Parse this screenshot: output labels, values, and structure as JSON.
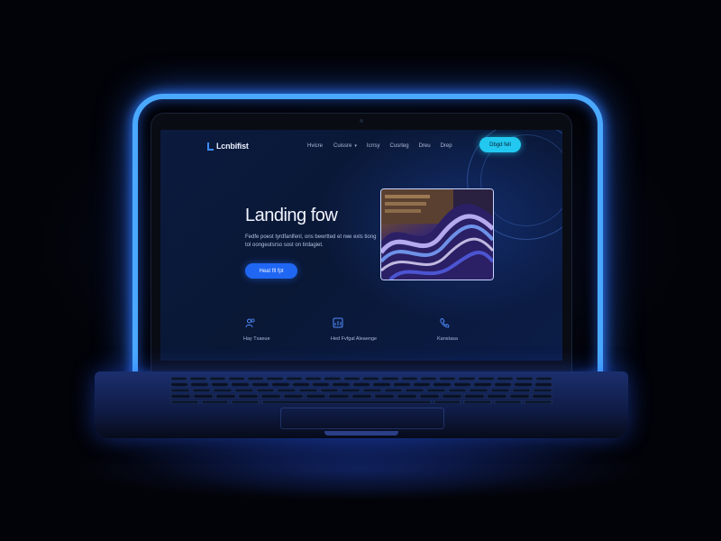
{
  "nav": {
    "logo_text": "Lcnbifist",
    "links": [
      "Hvicre",
      "Cuissre",
      "Icrrsy",
      "Cusrteg",
      "Dreu",
      "Drep"
    ],
    "cta_label": "Dbgd fell"
  },
  "hero": {
    "title": "Landing fow",
    "body": "Fedfe poest tyrdfanlfenl, ons bewrtted et rwe exls tiong tol oongeutsrso sost on tirdagiet.",
    "cta_label": "Heat fll fpt"
  },
  "features": [
    {
      "icon": "users-icon",
      "label": "Hay Txaeue"
    },
    {
      "icon": "chart-icon",
      "label": "Hed Fvfgal Aleaenge"
    },
    {
      "icon": "phone-icon",
      "label": "Kanstasa"
    }
  ],
  "colors": {
    "neon": "#4aa9ff",
    "accent_cyan": "#22c8f0",
    "accent_blue": "#1f66f2",
    "screen_bg": "#0b1a3d"
  }
}
